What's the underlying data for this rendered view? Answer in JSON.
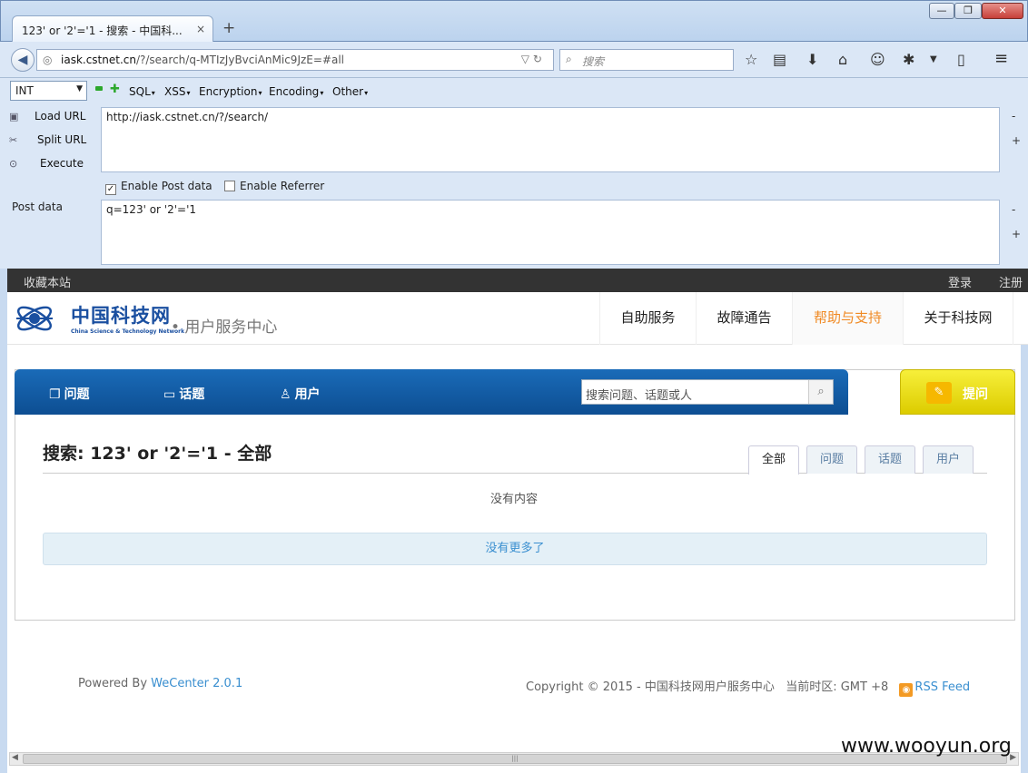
{
  "browser": {
    "tab_title": "123' or '2'='1 - 搜索 - 中国科...",
    "tab_close": "×",
    "new_tab": "+",
    "window_buttons": {
      "minimize": "—",
      "maximize": "❐",
      "close": "✕"
    },
    "url_host": "iask.cstnet.cn",
    "url_path": "/?/search/q-MTIzJyBvciAnMic9JzE=#all",
    "search_placeholder": "搜索"
  },
  "hackbar": {
    "encoding_select": "INT",
    "menus": [
      "SQL",
      "XSS",
      "Encryption",
      "Encoding",
      "Other"
    ],
    "load_url": "Load URL",
    "split_url": "Split URL",
    "execute": "Execute",
    "url_value": "http://iask.cstnet.cn/?/search/",
    "enable_post": "Enable Post data",
    "enable_referrer": "Enable Referrer",
    "post_label": "Post data",
    "post_value": "q=123' or '2'='1",
    "minus": "-",
    "plus": "+"
  },
  "site": {
    "bookmark": "收藏本站",
    "login": "登录",
    "register": "注册",
    "logo_cn": "中国科技网",
    "logo_en": "China Science & Technology Network",
    "logo_sub": "• 用户服务中心",
    "nav": [
      "自助服务",
      "故障通告",
      "帮助与支持",
      "关于科技网"
    ],
    "nav_active_index": 2,
    "tabs": [
      {
        "icon": "❐",
        "label": "问题"
      },
      {
        "icon": "▭",
        "label": "话题"
      },
      {
        "icon": "♙",
        "label": "用户"
      }
    ],
    "search_placeholder": "搜索问题、话题或人",
    "ask_label": "提问",
    "result_title": "搜索: 123' or '2'='1 - 全部",
    "result_tabs": [
      "全部",
      "问题",
      "话题",
      "用户"
    ],
    "no_content": "没有内容",
    "no_more": "没有更多了"
  },
  "footer": {
    "powered_by": "Powered By",
    "wecenter": "WeCenter 2.0.1",
    "copyright": "Copyright © 2015 - 中国科技网用户服务中心   当前时区: GMT +8",
    "rss": "RSS Feed"
  },
  "watermark": "www.wooyun.org",
  "colors": {
    "accent_blue": "#0d4e92",
    "ask_yellow": "#e8dc10",
    "active_nav": "#f08a24",
    "link": "#3a8fd0"
  }
}
